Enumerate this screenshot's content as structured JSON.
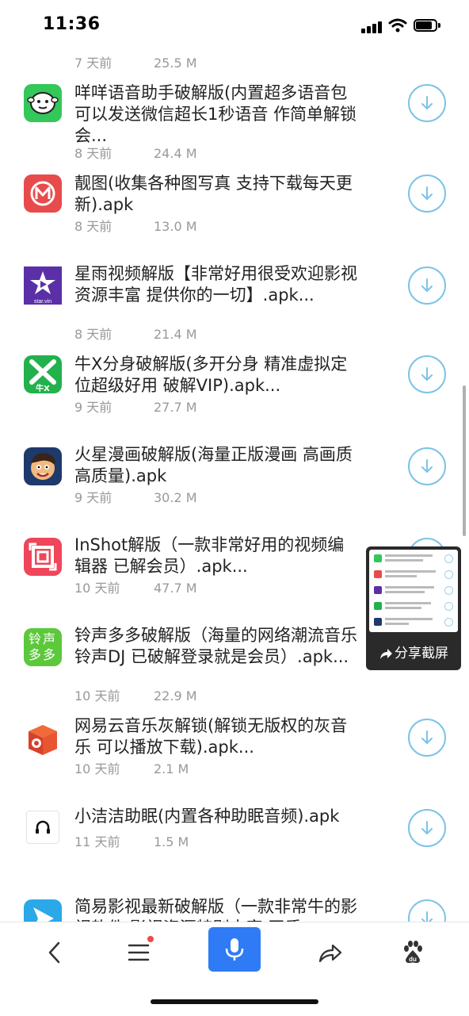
{
  "status_bar": {
    "time": "11:36"
  },
  "list": {
    "top_meta": {
      "age": "7 天前",
      "size": "25.5 M"
    },
    "items": [
      {
        "title": "咩咩语音助手破解版(内置超多语音包 可以发送微信超长1秒语音 作简单解锁会...",
        "age": "8 天前",
        "size": "24.4 M",
        "icon": "sheep-icon"
      },
      {
        "title": "靓图(收集各种图写真 支持下载每天更新).apk",
        "age": "8 天前",
        "size": "13.0 M",
        "icon": "m-circle-icon"
      },
      {
        "title": "星雨视频解版【非常好用很受欢迎影视资源丰富 提供你的一切】.apk...",
        "age": "8 天前",
        "size": "21.4 M",
        "icon": "star-video-icon",
        "icon_caption": "star.vin"
      },
      {
        "title": "牛X分身破解版(多开分身 精准虚拟定位超级好用 破解VIP).apk...",
        "age": "9 天前",
        "size": "27.7 M",
        "icon": "niux-icon",
        "icon_caption": "牛X"
      },
      {
        "title": "火星漫画破解版(海量正版漫画 高画质高质量).apk",
        "age": "9 天前",
        "size": "30.2 M",
        "icon": "cartoon-face-icon"
      },
      {
        "title": "InShot解版（一款非常好用的视频编辑器 已解会员）.apk...",
        "age": "10 天前",
        "size": "47.7 M",
        "icon": "inshot-icon"
      },
      {
        "title": "铃声多多破解版（海量的网络潮流音乐铃声DJ 已破解登录就是会员）.apk...",
        "age": "10 天前",
        "size": "22.9 M",
        "icon": "ringtone-icon",
        "icon_text": "铃声多多"
      },
      {
        "title": "网易云音乐灰解锁(解锁无版权的灰音乐 可以播放下载).apk...",
        "age": "10 天前",
        "size": "2.1 M",
        "icon": "music-box-icon"
      },
      {
        "title": "小洁洁助眠(内置各种助眠音频).apk",
        "age": "11 天前",
        "size": "1.5 M",
        "icon": "headphones-icon"
      },
      {
        "title": "简易影视最新破解版（一款非常牛的影视软件 影视资源特别丰富 画质...",
        "age": "",
        "size": "",
        "icon": "play-icon"
      }
    ]
  },
  "share_popup": {
    "label": "分享截屏"
  },
  "bottom_bar": {
    "items": [
      "back-icon",
      "menu-icon",
      "mic-icon",
      "share-icon",
      "baidu-paw-icon"
    ],
    "baidu_text": "du"
  },
  "colors": {
    "accent": "#2f7bf5",
    "download_ring": "#7cc3e8",
    "meta_text": "#999999"
  }
}
